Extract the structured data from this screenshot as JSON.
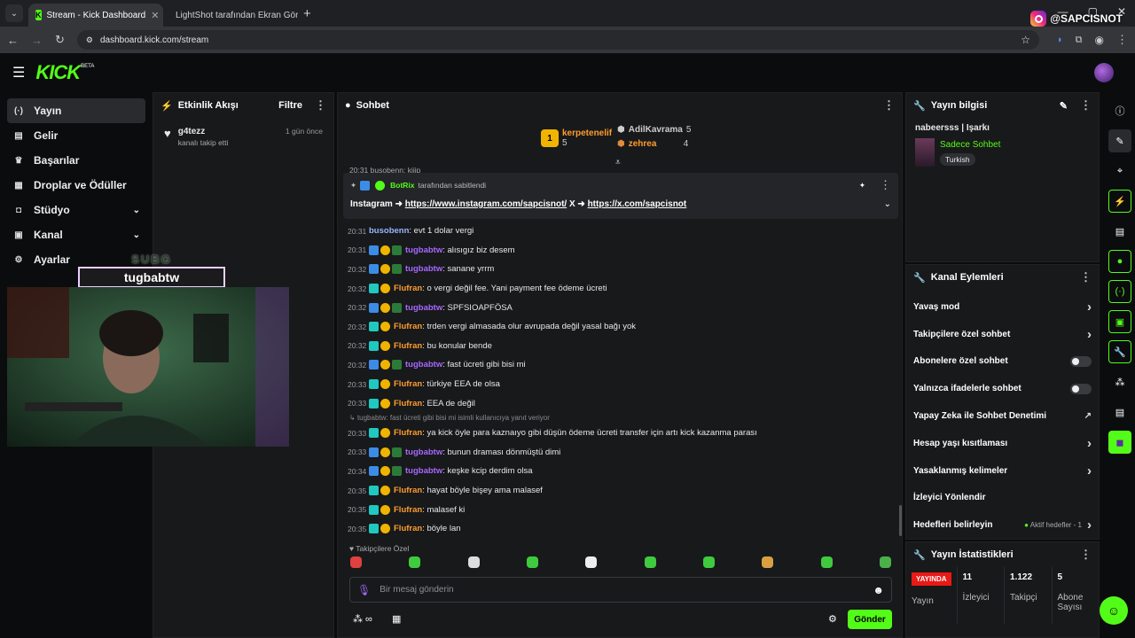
{
  "browser": {
    "tabs": [
      {
        "title": "Stream - Kick Dashboard",
        "active": true
      },
      {
        "title": "LightShot tarafından Ekran Görü",
        "active": false
      }
    ],
    "url": "dashboard.kick.com/stream"
  },
  "overlay": {
    "instagram_handle": "@SAPCISNOT",
    "subg_title": "SUBG",
    "subg_name": "tugbabtw"
  },
  "brand": {
    "logo": "KICK",
    "beta": "BETA",
    "accent": "#53fc18"
  },
  "sidebar": {
    "items": [
      {
        "label": "Yayın",
        "icon": "broadcast-icon"
      },
      {
        "label": "Gelir",
        "icon": "revenue-icon"
      },
      {
        "label": "Başarılar",
        "icon": "trophy-icon"
      },
      {
        "label": "Droplar ve Ödüller",
        "icon": "gift-icon"
      },
      {
        "label": "Stüdyo",
        "icon": "studio-icon"
      },
      {
        "label": "Kanal",
        "icon": "channel-icon"
      },
      {
        "label": "Ayarlar",
        "icon": "gear-icon"
      }
    ]
  },
  "activity": {
    "title": "Etkinlik Akışı",
    "filter": "Filtre",
    "items": [
      {
        "user": "g4tezz",
        "action": "kanalı takip etti",
        "time": "1 gün önce"
      }
    ]
  },
  "chat": {
    "title": "Sohbet",
    "leaders": [
      {
        "name": "kerpetenelif",
        "count": "5"
      },
      {
        "name": "AdilKavrama",
        "count": "5"
      },
      {
        "name": "zehrea",
        "count": "4"
      }
    ],
    "cut_line": "20:31 busobenn: kiiip",
    "pinned": {
      "by": "BotRix",
      "by_suffix": "tarafından sabitlendi",
      "text_prefix": "Instagram ➜",
      "link1": "https://www.instagram.com/sapcisnot/",
      "mid": "X ➜",
      "link2": "https://x.com/sapcisnot"
    },
    "messages": [
      {
        "time": "20:31",
        "user": "busobenn",
        "text": ": evt 1 dolar vergi",
        "color": "blue",
        "badges": 0
      },
      {
        "time": "20:31",
        "user": "tugbabtw",
        "text": ": alısıgız biz desem",
        "color": "purple",
        "badges": 3
      },
      {
        "time": "20:32",
        "user": "tugbabtw",
        "text": ": sanane yrrm",
        "color": "purple",
        "badges": 3
      },
      {
        "time": "20:32",
        "user": "Flufran",
        "text": ": o vergi değil fee. Yani payment fee ödeme ücreti",
        "color": "orange",
        "badges": 2
      },
      {
        "time": "20:32",
        "user": "tugbabtw",
        "text": ": SPFSIOAPFÖSA",
        "color": "purple",
        "badges": 3
      },
      {
        "time": "20:32",
        "user": "Flufran",
        "text": ": trden vergi almasada olur avrupada değil yasal bağı yok",
        "color": "orange",
        "badges": 2
      },
      {
        "time": "20:32",
        "user": "Flufran",
        "text": ": bu konular bende",
        "color": "orange",
        "badges": 2
      },
      {
        "time": "20:32",
        "user": "tugbabtw",
        "text": ": fast ücreti gibi bisi mi",
        "color": "purple",
        "badges": 3
      },
      {
        "time": "20:33",
        "user": "Flufran",
        "text": ": türkiye EEA de olsa",
        "color": "orange",
        "badges": 2
      },
      {
        "time": "20:33",
        "user": "Flufran",
        "text": ": EEA de değil",
        "color": "orange",
        "badges": 2
      }
    ],
    "reply_hint": "tugbabtw: fast ücreti gibi bisi mi isimli kullanıcıya yanıt veriyor",
    "messages2": [
      {
        "time": "20:33",
        "user": "Flufran",
        "text": ": ya kick öyle para kaznaıyo gibi düşün ödeme ücreti transfer için artı kick kazanma parası",
        "color": "orange",
        "badges": 2
      },
      {
        "time": "20:33",
        "user": "tugbabtw",
        "text": ": bunun draması dönmüştü dimi",
        "color": "purple",
        "badges": 3
      },
      {
        "time": "20:34",
        "user": "tugbabtw",
        "text": ": keşke kcip derdim olsa",
        "color": "purple",
        "badges": 3
      },
      {
        "time": "20:35",
        "user": "Flufran",
        "text": ": hayat böyle bişey ama malasef",
        "color": "orange",
        "badges": 2
      },
      {
        "time": "20:35",
        "user": "Flufran",
        "text": ": malasef ki",
        "color": "orange",
        "badges": 2
      },
      {
        "time": "20:35",
        "user": "Flufran",
        "text": ": böyle lan",
        "color": "orange",
        "badges": 2
      }
    ],
    "followers_only": "Takipçilere Özel",
    "input_placeholder": "Bir mesaj gönderin",
    "send": "Gönder"
  },
  "stream_info": {
    "title": "Yayın bilgisi",
    "stream_title": "nabeersss | Işarkı",
    "category": "Sadece Sohbet",
    "tag": "Turkish"
  },
  "channel_actions": {
    "title": "Kanal Eylemleri",
    "rows": [
      {
        "label": "Yavaş mod",
        "control": "chevron"
      },
      {
        "label": "Takipçilere özel sohbet",
        "control": "chevron"
      },
      {
        "label": "Abonelere özel sohbet",
        "control": "toggle"
      },
      {
        "label": "Yalnızca ifadelerle sohbet",
        "control": "toggle"
      },
      {
        "label": "Yapay Zeka ile Sohbet Denetimi",
        "control": "external"
      },
      {
        "label": "Hesap yaşı kısıtlaması",
        "control": "chevron"
      },
      {
        "label": "Yasaklanmış kelimeler",
        "control": "chevron"
      },
      {
        "label": "İzleyici Yönlendir",
        "control": "none"
      },
      {
        "label": "Hedefleri belirleyin",
        "control": "chevron",
        "status": "Aktif hedefler - 1"
      }
    ]
  },
  "stats": {
    "title": "Yayın İstatistikleri",
    "items": [
      {
        "value": "YAYINDA",
        "label": "Yayın"
      },
      {
        "value": "11",
        "label": "İzleyici"
      },
      {
        "value": "1.122",
        "label": "Takipçi"
      },
      {
        "value": "5",
        "label": "Abone Sayısı"
      }
    ]
  }
}
